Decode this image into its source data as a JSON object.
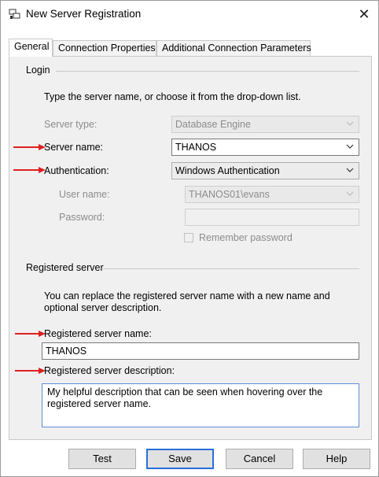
{
  "window": {
    "title": "New Server Registration",
    "close_label": "✕"
  },
  "tabs": [
    {
      "label": "General",
      "active": true
    },
    {
      "label": "Connection Properties",
      "active": false
    },
    {
      "label": "Additional Connection Parameters",
      "active": false
    }
  ],
  "login": {
    "group_label": "Login",
    "instruction": "Type the server name, or choose it from the drop-down list.",
    "server_type_label": "Server type:",
    "server_type_value": "Database Engine",
    "server_name_label": "Server name:",
    "server_name_value": "THANOS",
    "authentication_label": "Authentication:",
    "authentication_value": "Windows Authentication",
    "user_name_label": "User name:",
    "user_name_value": "THANOS01\\evans",
    "password_label": "Password:",
    "password_value": "",
    "remember_password_label": "Remember password"
  },
  "registered": {
    "group_label": "Registered server",
    "instruction": "You can replace the registered server name with a new name and optional server description.",
    "name_label": "Registered server name:",
    "name_value": "THANOS",
    "description_label": "Registered server description:",
    "description_value": "My helpful description that can be seen when hovering over the registered server name."
  },
  "buttons": {
    "test": "Test",
    "save": "Save",
    "cancel": "Cancel",
    "help": "Help"
  },
  "colors": {
    "annotation_arrow": "#e02020",
    "focus_blue": "#2a6fd8"
  }
}
